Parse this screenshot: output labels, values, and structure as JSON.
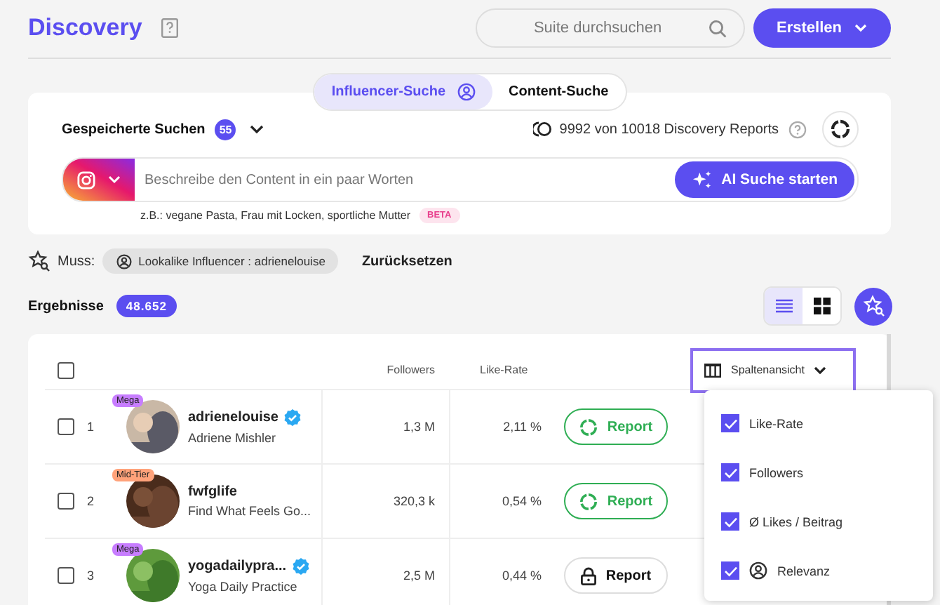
{
  "header": {
    "title": "Discovery",
    "search": {
      "placeholder": "Suite durchsuchen"
    },
    "create_button": "Erstellen"
  },
  "search_tabs": [
    {
      "label": "Influencer-Suche",
      "selected": true
    },
    {
      "label": "Content-Suche",
      "selected": false
    }
  ],
  "search_card": {
    "saved_searches": {
      "label": "Gespeicherte Suchen",
      "count": "55"
    },
    "reports": "9992 von 10018 Discovery Reports",
    "prompt": {
      "placeholder": "Beschreibe den Content in ein paar Worten"
    },
    "ai_button": "AI Suche starten",
    "hint": "z.B.: vegane Pasta, Frau mit Locken, sportliche Mutter",
    "hint_badge": "BETA"
  },
  "filters": {
    "label": "Muss:",
    "chips": [
      "Lookalike Influencer : adrienelouise"
    ],
    "reset": "Zurücksetzen"
  },
  "results": {
    "label": "Ergebnisse",
    "count": "48.652",
    "views": [
      {
        "kind": "list",
        "selected": true
      },
      {
        "kind": "grid",
        "selected": false
      }
    ]
  },
  "table": {
    "columns": [
      "Followers",
      "Like-Rate"
    ],
    "column_view_button": "Spaltenansicht",
    "all_checked": false,
    "rows": [
      {
        "checked": false,
        "rank": "1",
        "tier": "Mega",
        "color": "#c77dff",
        "handle": "adrienelouise",
        "verified": true,
        "name": "Adriene Mishler",
        "followers": "1,3 M",
        "like_rate": "2,11 %",
        "report": {
          "kind": "loading",
          "label": "Report"
        }
      },
      {
        "checked": false,
        "rank": "2",
        "tier": "Mid-Tier",
        "color": "#ffa27a",
        "handle": "fwfglife",
        "verified": false,
        "name": "Find What Feels Go...",
        "followers": "320,3 k",
        "like_rate": "0,54 %",
        "report": {
          "kind": "loading",
          "label": "Report"
        }
      },
      {
        "checked": false,
        "rank": "3",
        "tier": "Mega",
        "color": "#c77dff",
        "handle": "yogadailypra...",
        "verified": true,
        "name": "Yoga Daily Practice",
        "followers": "2,5 M",
        "like_rate": "0,44 %",
        "report": {
          "kind": "locked",
          "label": "Report"
        }
      }
    ]
  },
  "column_menu": [
    {
      "label": "Like-Rate",
      "checked": true,
      "icon": false
    },
    {
      "label": "Followers",
      "checked": true,
      "icon": false
    },
    {
      "label": "Ø Likes / Beitrag",
      "checked": true,
      "icon": false
    },
    {
      "label": "Relevanz",
      "checked": true,
      "icon": true
    }
  ]
}
